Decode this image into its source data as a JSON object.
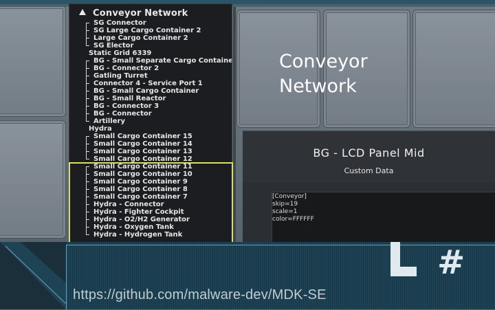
{
  "lcd_list": {
    "title": "Conveyor Network",
    "items": [
      "SG Connector",
      "SG Large Cargo Container 2",
      "Large Cargo Container 2",
      "SG Elector",
      "Static Grid 6339",
      "BG - Small Separate Cargo Container",
      "BG - Connector 2",
      "Gatling Turret",
      "Connector 4 - Service Port 1",
      "BG - Small Cargo Container",
      "BG - Small Reactor",
      "BG - Connector 3",
      "BG - Connector",
      "Artillery",
      "Hydra",
      "Small Cargo Container 15",
      "Small Cargo Container 14",
      "Small Cargo Container 13",
      "Small Cargo Container 12",
      "Small Cargo Container 11",
      "Small Cargo Container 10",
      "Small Cargo Container 9",
      "Small Cargo Container 8",
      "Small Cargo Container 7",
      "Hydra - Connector",
      "Hydra - Fighter Cockpit",
      "Hydra - O2/H2 Generator",
      "Hydra - Oxygen Tank",
      "Hydra - Hydrogen Tank"
    ]
  },
  "float_label": {
    "line1": "Conveyor",
    "line2": "Network"
  },
  "lcd_panel": {
    "title": "BG - LCD Panel Mid",
    "subtitle": "Custom Data",
    "custom_data": [
      "[Conveyor]",
      "skip=19",
      "scale=1",
      "color=FFFFFF"
    ]
  },
  "banner": {
    "repo_url": "https://github.com/malware-dev/MDK-SE",
    "logo_text": "L#"
  },
  "colors": {
    "highlight": "#d9e06a",
    "banner": "#1d4355",
    "lcd_bg": "#1b1d20"
  }
}
